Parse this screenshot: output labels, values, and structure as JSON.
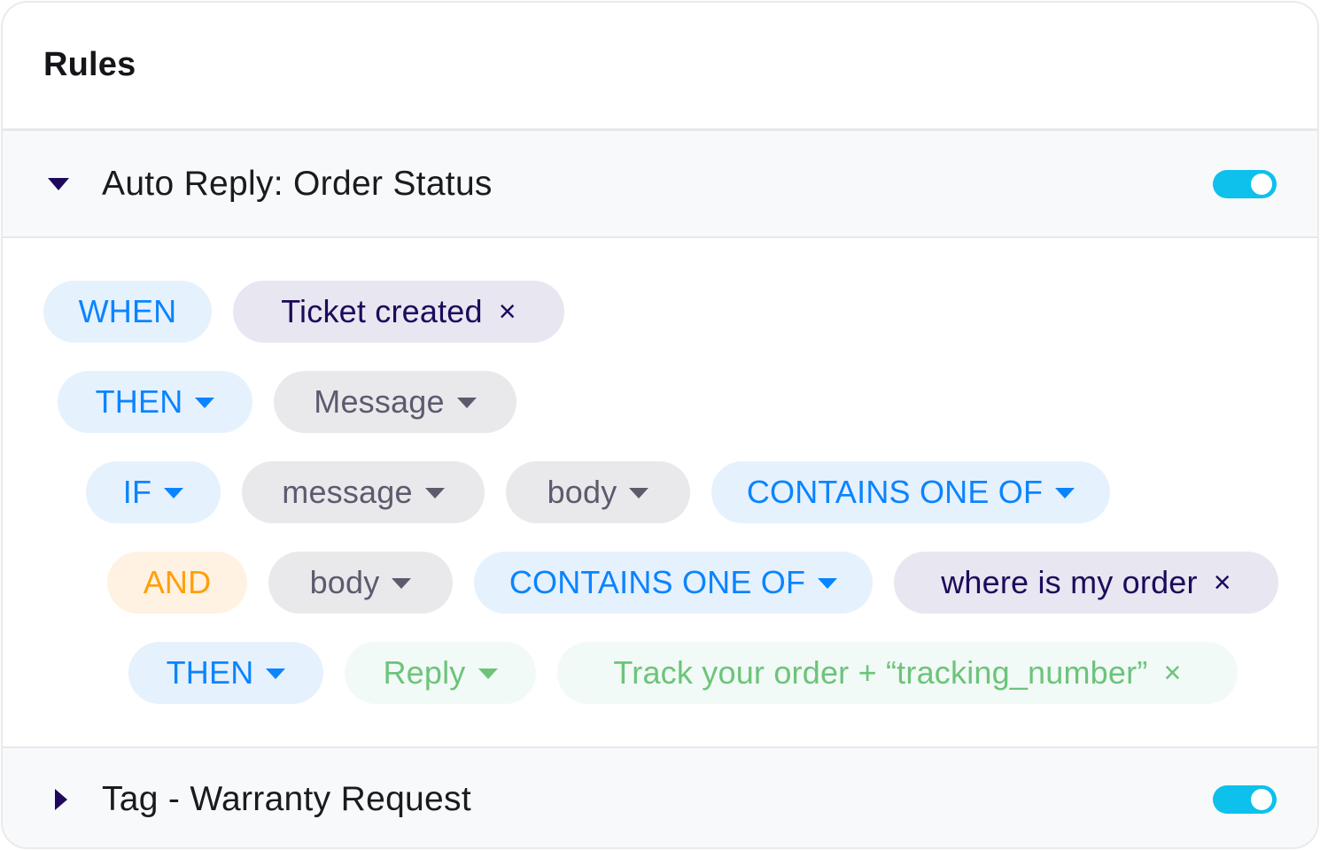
{
  "panel": {
    "title": "Rules"
  },
  "colors": {
    "toggle_on": "#0ec0ec",
    "keyword_blue": "#0a84ff",
    "and_orange": "#ff9f0a",
    "value_purple": "#1e0a5c",
    "reply_green": "#6cc47a",
    "caret_dark": "#1e0a5c"
  },
  "rules": [
    {
      "name": "Auto Reply: Order Status",
      "expanded": true,
      "enabled": true,
      "expand_icon": "caret-down-icon",
      "lines": [
        {
          "keyword": "WHEN",
          "chips": [
            {
              "label": "Ticket created",
              "removable": true,
              "remove_icon": "close-icon"
            }
          ]
        },
        {
          "keyword": "THEN",
          "keyword_dropdown": true,
          "chips": [
            {
              "label": "Message",
              "dropdown": true
            }
          ]
        },
        {
          "keyword": "IF",
          "keyword_dropdown": true,
          "chips": [
            {
              "label": "message",
              "dropdown": true
            },
            {
              "label": "body",
              "dropdown": true
            },
            {
              "label": "CONTAINS ONE OF",
              "dropdown": true
            }
          ]
        },
        {
          "keyword": "AND",
          "chips": [
            {
              "label": "body",
              "dropdown": true
            },
            {
              "label": "CONTAINS ONE OF",
              "dropdown": true
            },
            {
              "label": "where is my order",
              "removable": true,
              "remove_icon": "close-icon"
            }
          ]
        },
        {
          "keyword": "THEN",
          "keyword_dropdown": true,
          "chips": [
            {
              "label": "Reply",
              "dropdown": true
            },
            {
              "label": "Track your order + “tracking_number”",
              "removable": true,
              "remove_icon": "close-icon"
            }
          ]
        }
      ]
    },
    {
      "name": "Tag - Warranty Request",
      "expanded": false,
      "enabled": true,
      "expand_icon": "caret-right-icon"
    }
  ],
  "close_glyph": "×"
}
